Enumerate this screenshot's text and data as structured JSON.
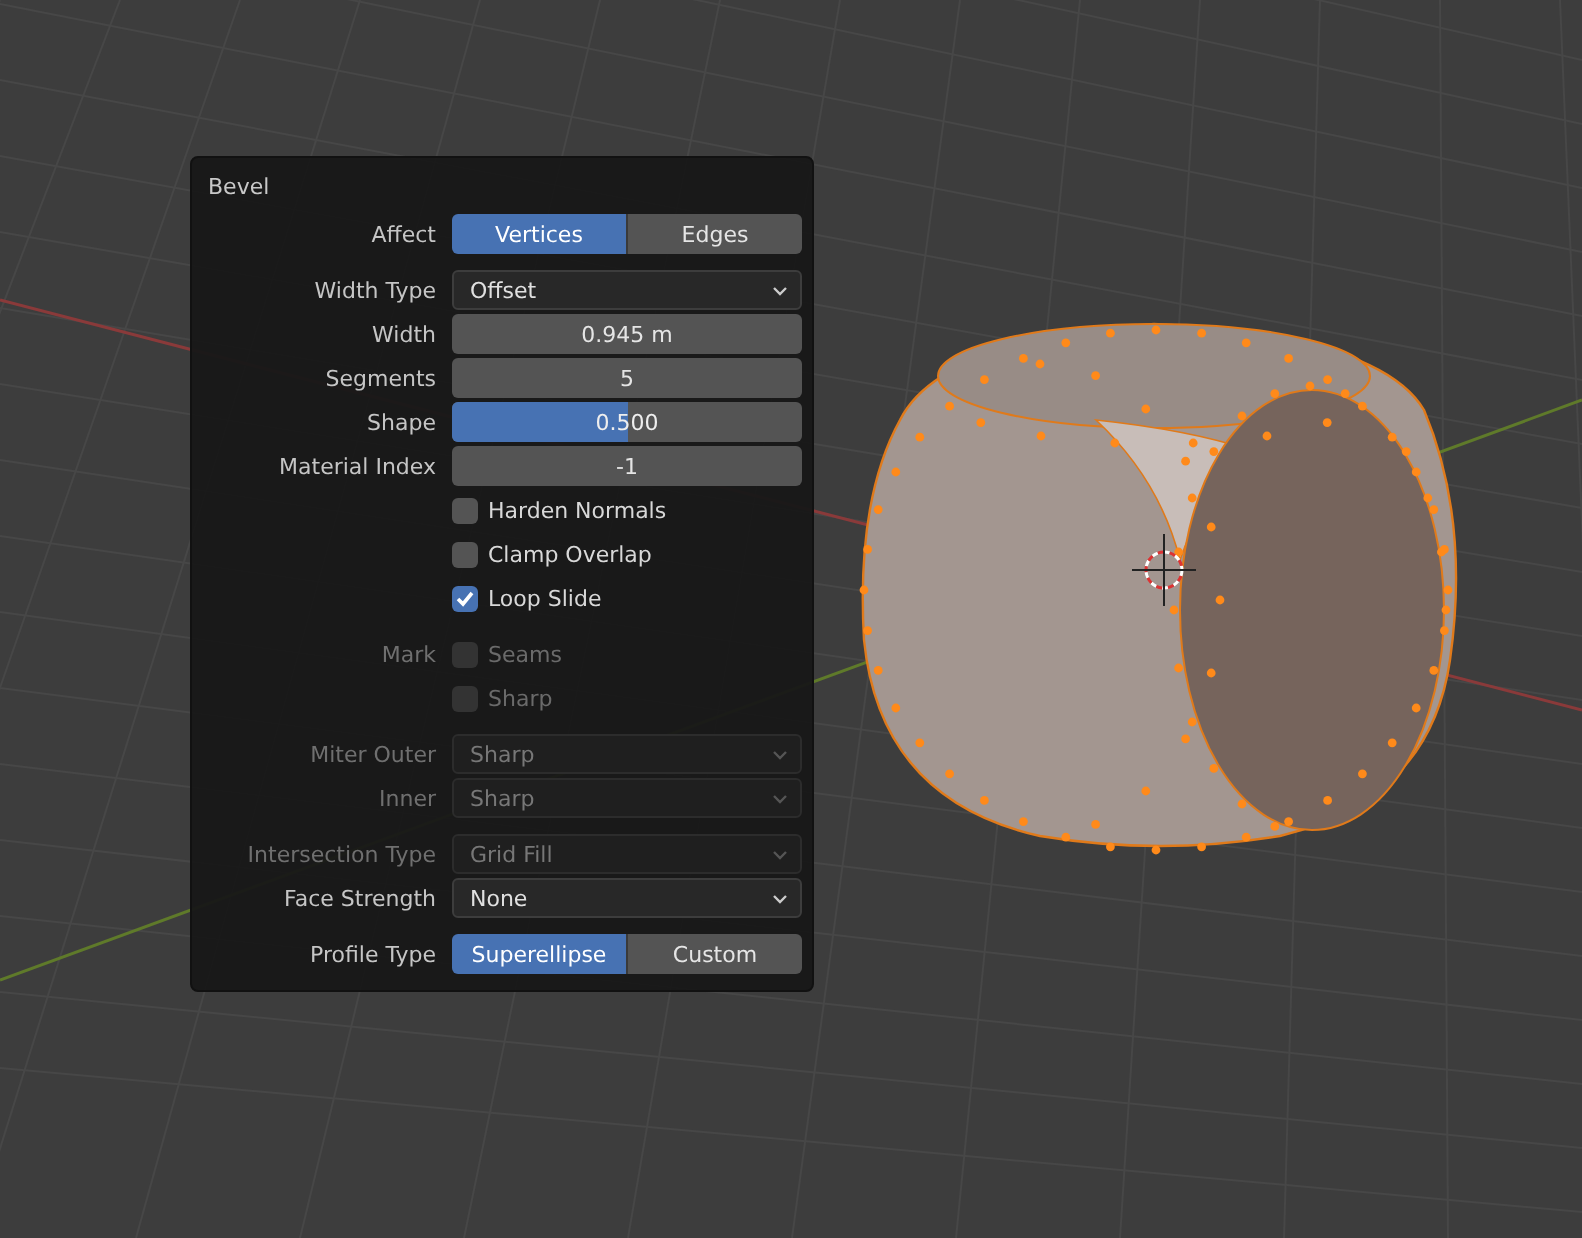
{
  "panel": {
    "title": "Bevel",
    "sections": [
      {
        "rows": [
          {
            "kind": "toggle",
            "label": "Affect",
            "options": [
              {
                "label": "Vertices",
                "selected": true
              },
              {
                "label": "Edges",
                "selected": false
              }
            ]
          }
        ]
      },
      {
        "rows": [
          {
            "kind": "dropdown",
            "label": "Width Type",
            "value": "Offset",
            "disabled": false
          },
          {
            "kind": "number",
            "label": "Width",
            "value": "0.945 m"
          },
          {
            "kind": "number",
            "label": "Segments",
            "value": "5"
          },
          {
            "kind": "slider",
            "label": "Shape",
            "value": "0.500",
            "level": 0.5
          },
          {
            "kind": "number",
            "label": "Material Index",
            "value": "-1"
          },
          {
            "kind": "checkbox",
            "text": "Harden Normals",
            "checked": false,
            "disabled": false
          },
          {
            "kind": "checkbox",
            "text": "Clamp Overlap",
            "checked": false,
            "disabled": false
          },
          {
            "kind": "checkbox",
            "text": "Loop Slide",
            "checked": true,
            "disabled": false
          }
        ]
      },
      {
        "rows": [
          {
            "kind": "checkbox",
            "label": "Mark",
            "text": "Seams",
            "checked": false,
            "disabled": true
          },
          {
            "kind": "checkbox",
            "text": "Sharp",
            "checked": false,
            "disabled": true
          }
        ]
      },
      {
        "rows": [
          {
            "kind": "dropdown",
            "label": "Miter Outer",
            "value": "Sharp",
            "disabled": true
          },
          {
            "kind": "dropdown",
            "label": "Inner",
            "value": "Sharp",
            "disabled": true
          }
        ]
      },
      {
        "rows": [
          {
            "kind": "dropdown",
            "label": "Intersection Type",
            "value": "Grid Fill",
            "disabled": true
          },
          {
            "kind": "dropdown",
            "label": "Face Strength",
            "value": "None",
            "disabled": false
          }
        ]
      },
      {
        "rows": [
          {
            "kind": "toggle",
            "label": "Profile Type",
            "options": [
              {
                "label": "Superellipse",
                "selected": true
              },
              {
                "label": "Custom",
                "selected": false
              }
            ]
          }
        ]
      }
    ]
  }
}
